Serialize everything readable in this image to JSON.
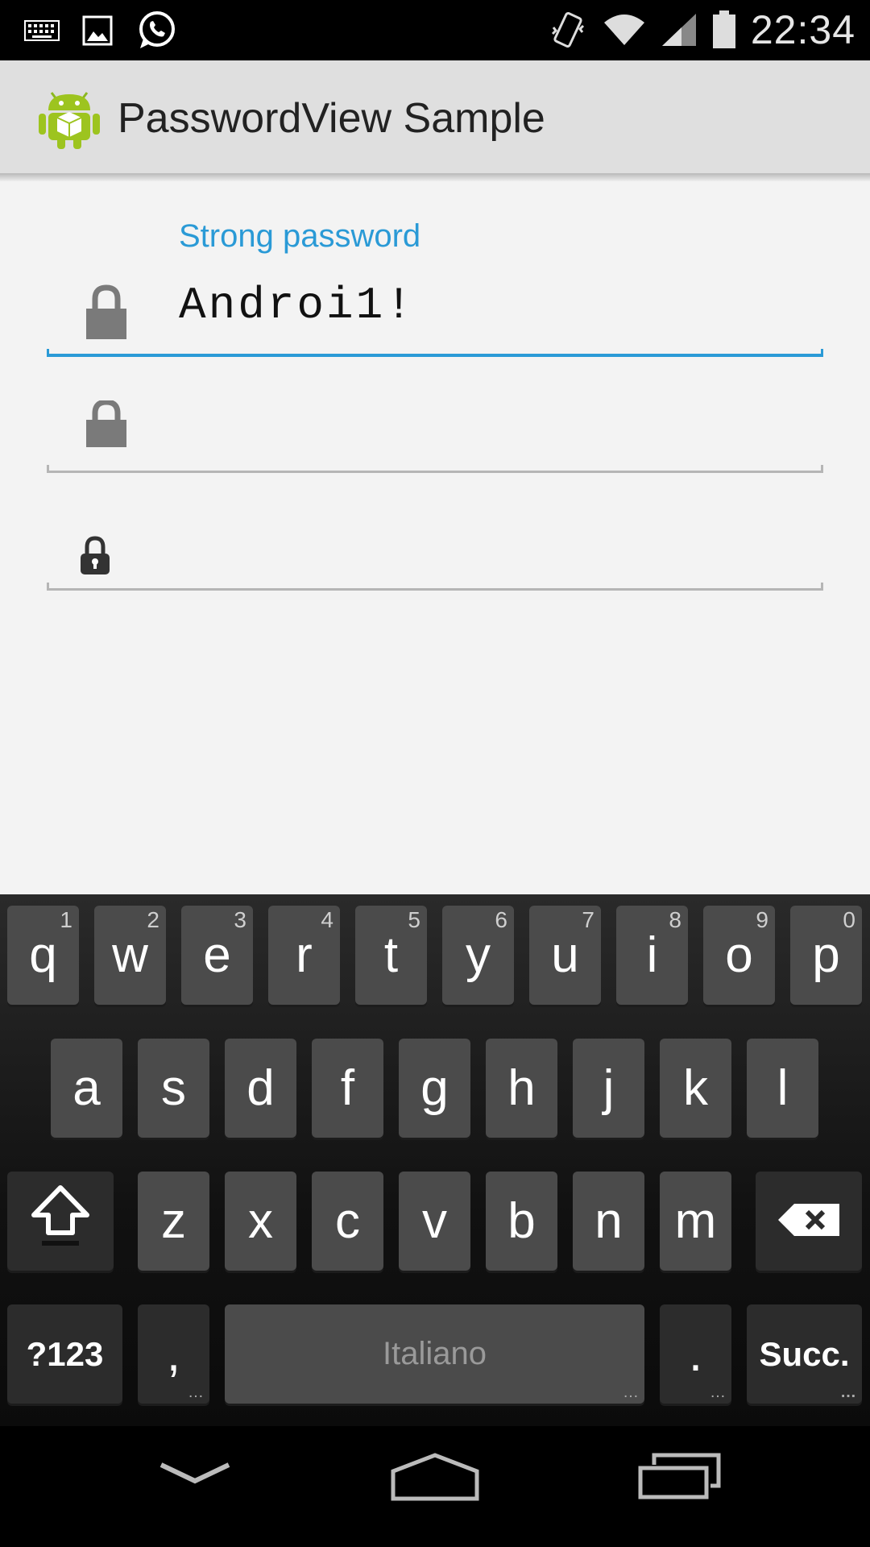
{
  "status_bar": {
    "time": "22:34",
    "left_icons": [
      "keyboard-icon",
      "image-icon",
      "whatsapp-icon"
    ],
    "right_icons": [
      "vibrate-icon",
      "wifi-icon",
      "signal-icon",
      "battery-icon"
    ]
  },
  "action_bar": {
    "title": "PasswordView Sample",
    "icon": "android-app-icon"
  },
  "form": {
    "label": "Strong password",
    "fields": [
      {
        "value": "Androi1!",
        "icon": "lock-icon"
      },
      {
        "value": "",
        "icon": "lock-icon"
      },
      {
        "value": "",
        "icon": "small-lock-icon"
      }
    ]
  },
  "keyboard": {
    "row1": [
      {
        "k": "q",
        "h": "1"
      },
      {
        "k": "w",
        "h": "2"
      },
      {
        "k": "e",
        "h": "3"
      },
      {
        "k": "r",
        "h": "4"
      },
      {
        "k": "t",
        "h": "5"
      },
      {
        "k": "y",
        "h": "6"
      },
      {
        "k": "u",
        "h": "7"
      },
      {
        "k": "i",
        "h": "8"
      },
      {
        "k": "o",
        "h": "9"
      },
      {
        "k": "p",
        "h": "0"
      }
    ],
    "row2": [
      "a",
      "s",
      "d",
      "f",
      "g",
      "h",
      "j",
      "k",
      "l"
    ],
    "row3": [
      "z",
      "x",
      "c",
      "v",
      "b",
      "n",
      "m"
    ],
    "symbols_label": "?123",
    "comma": ",",
    "space_label": "Italiano",
    "period": ".",
    "next_label": "Succ.",
    "shift_icon": "shift-icon",
    "delete_icon": "backspace-icon"
  },
  "nav_bar": {
    "icons": [
      "hide-keyboard-icon",
      "home-icon",
      "recents-icon"
    ]
  },
  "colors": {
    "accent": "#2a9ad6",
    "action_bar_bg": "#dfdfdf",
    "content_bg": "#f3f3f3",
    "key_bg": "#4b4b4b"
  }
}
